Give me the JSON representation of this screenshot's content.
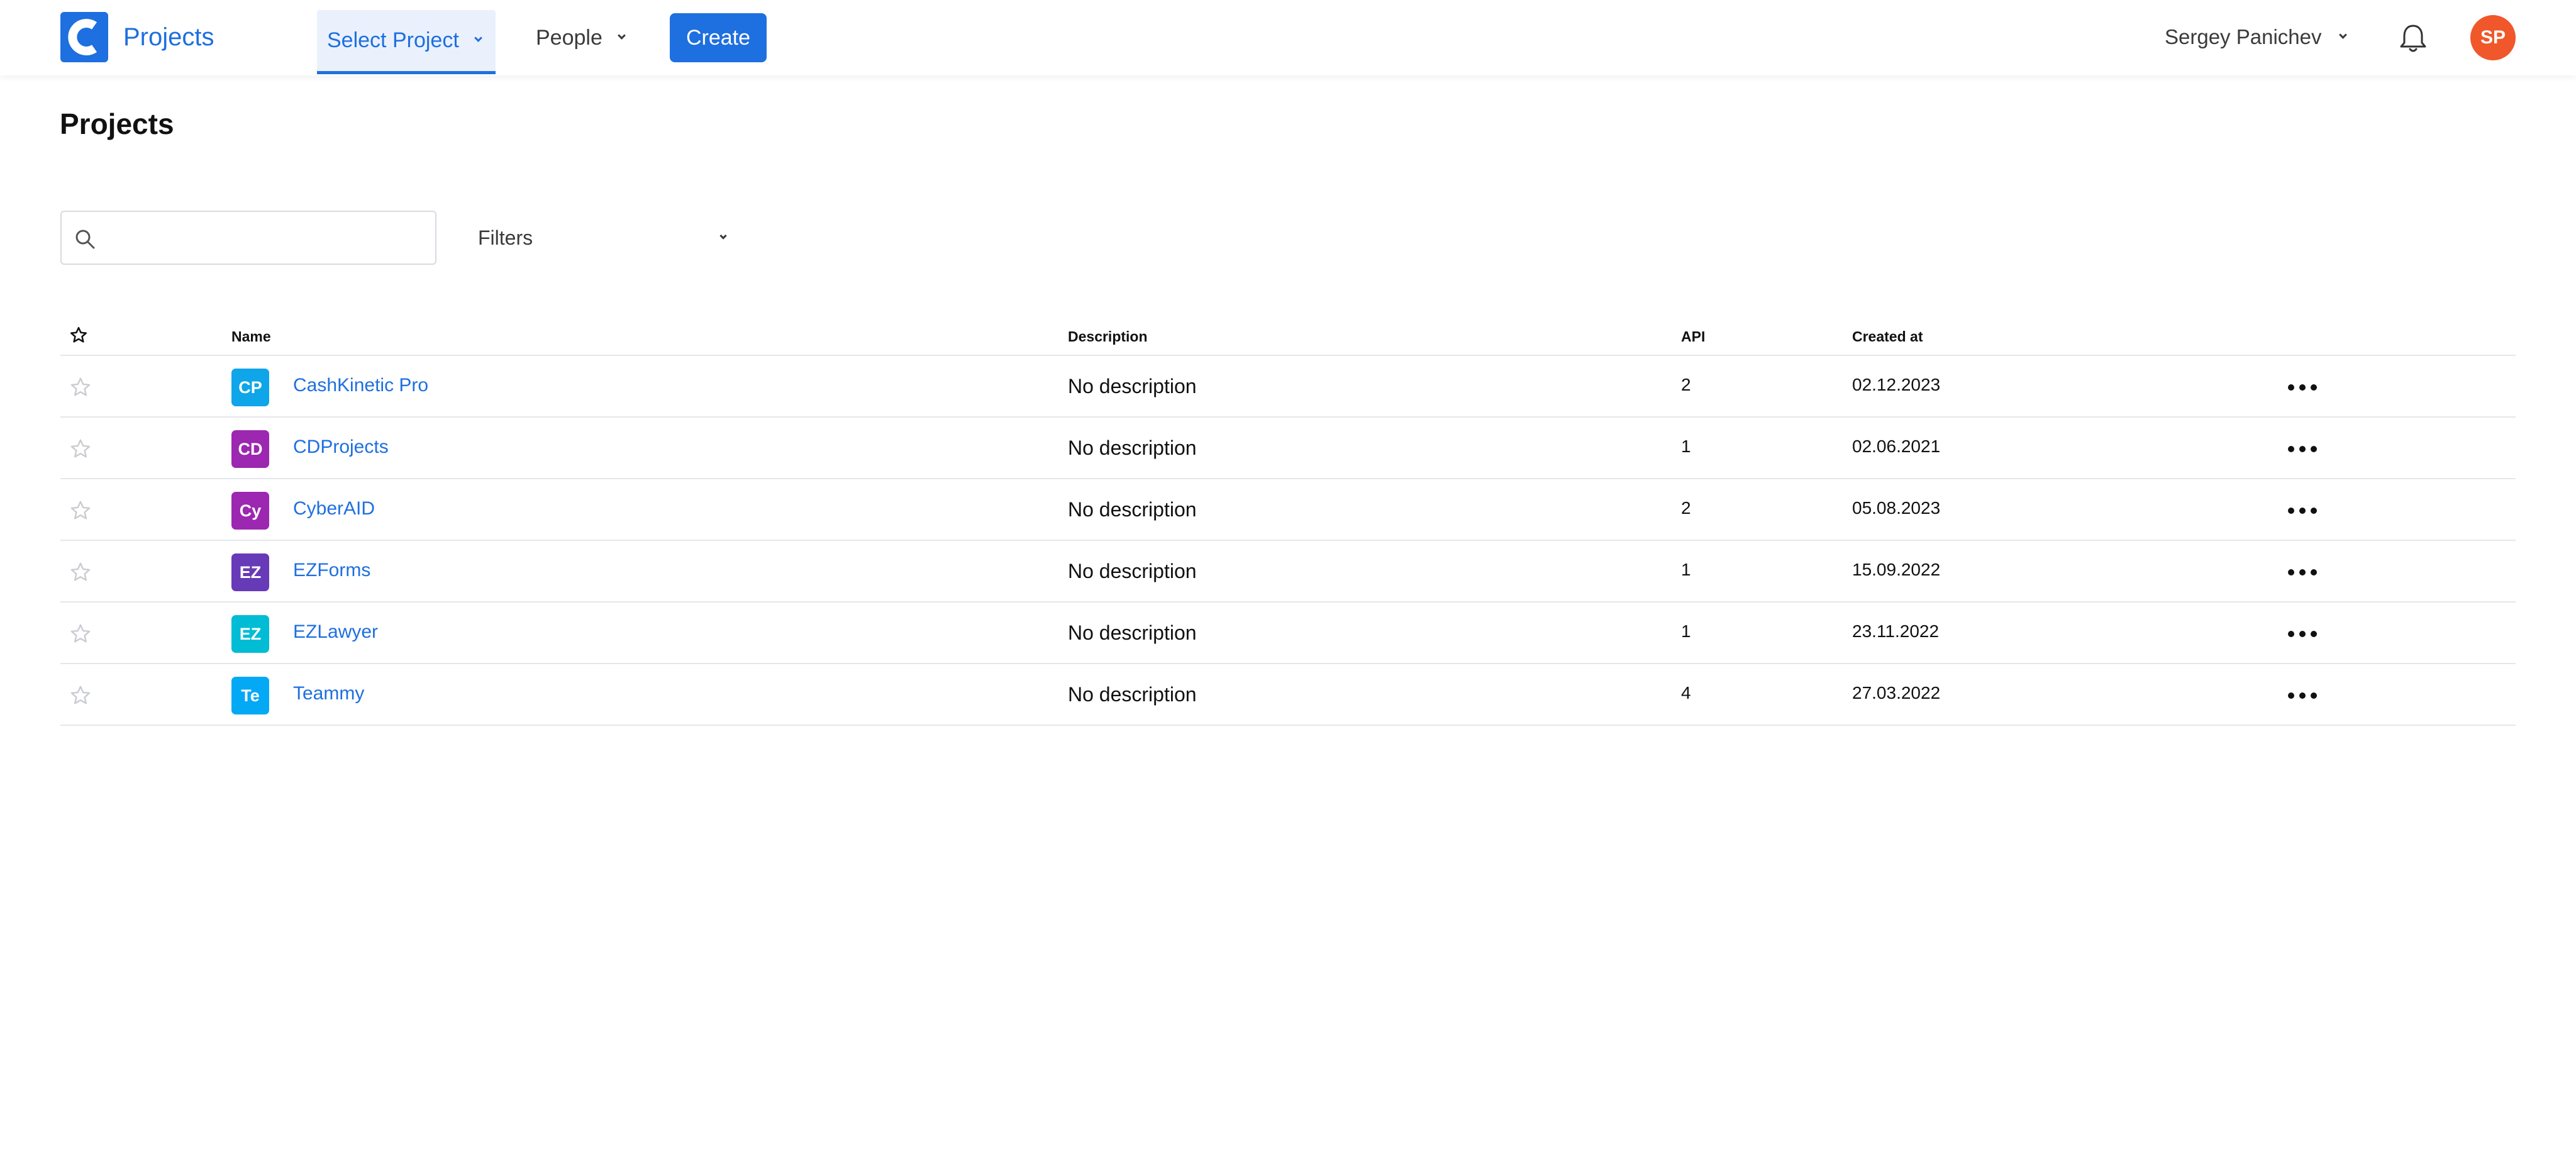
{
  "brand": {
    "name": "Projects",
    "color": "#1e6fe0"
  },
  "nav": {
    "select_project": "Select Project",
    "people": "People",
    "create": "Create"
  },
  "user": {
    "name": "Sergey Panichev",
    "initials": "SP",
    "avatar_color": "#f0572a"
  },
  "page": {
    "title": "Projects"
  },
  "search": {
    "placeholder": "",
    "value": ""
  },
  "filters": {
    "label": "Filters"
  },
  "table": {
    "headers": {
      "name": "Name",
      "description": "Description",
      "api": "API",
      "created_at": "Created at"
    },
    "rows": [
      {
        "initials": "CP",
        "badge_color": "#0ea5e9",
        "name": "CashKinetic Pro",
        "description": "No description",
        "api": "2",
        "created_at": "02.12.2023"
      },
      {
        "initials": "CD",
        "badge_color": "#9c27b0",
        "name": "CDProjects",
        "description": "No description",
        "api": "1",
        "created_at": "02.06.2021"
      },
      {
        "initials": "Cy",
        "badge_color": "#9c27b0",
        "name": "CyberAID",
        "description": "No description",
        "api": "2",
        "created_at": "05.08.2023"
      },
      {
        "initials": "EZ",
        "badge_color": "#673ab7",
        "name": "EZForms",
        "description": "No description",
        "api": "1",
        "created_at": "15.09.2022"
      },
      {
        "initials": "EZ",
        "badge_color": "#00bcd4",
        "name": "EZLawyer",
        "description": "No description",
        "api": "1",
        "created_at": "23.11.2022"
      },
      {
        "initials": "Te",
        "badge_color": "#03a9f4",
        "name": "Teammy",
        "description": "No description",
        "api": "4",
        "created_at": "27.03.2022"
      }
    ]
  },
  "icons": {
    "logo": "logo-icon",
    "chevron": "chevron-down-icon",
    "bell": "bell-icon",
    "search": "search-icon",
    "star": "star-outline-icon",
    "more": "more-horizontal-icon"
  }
}
